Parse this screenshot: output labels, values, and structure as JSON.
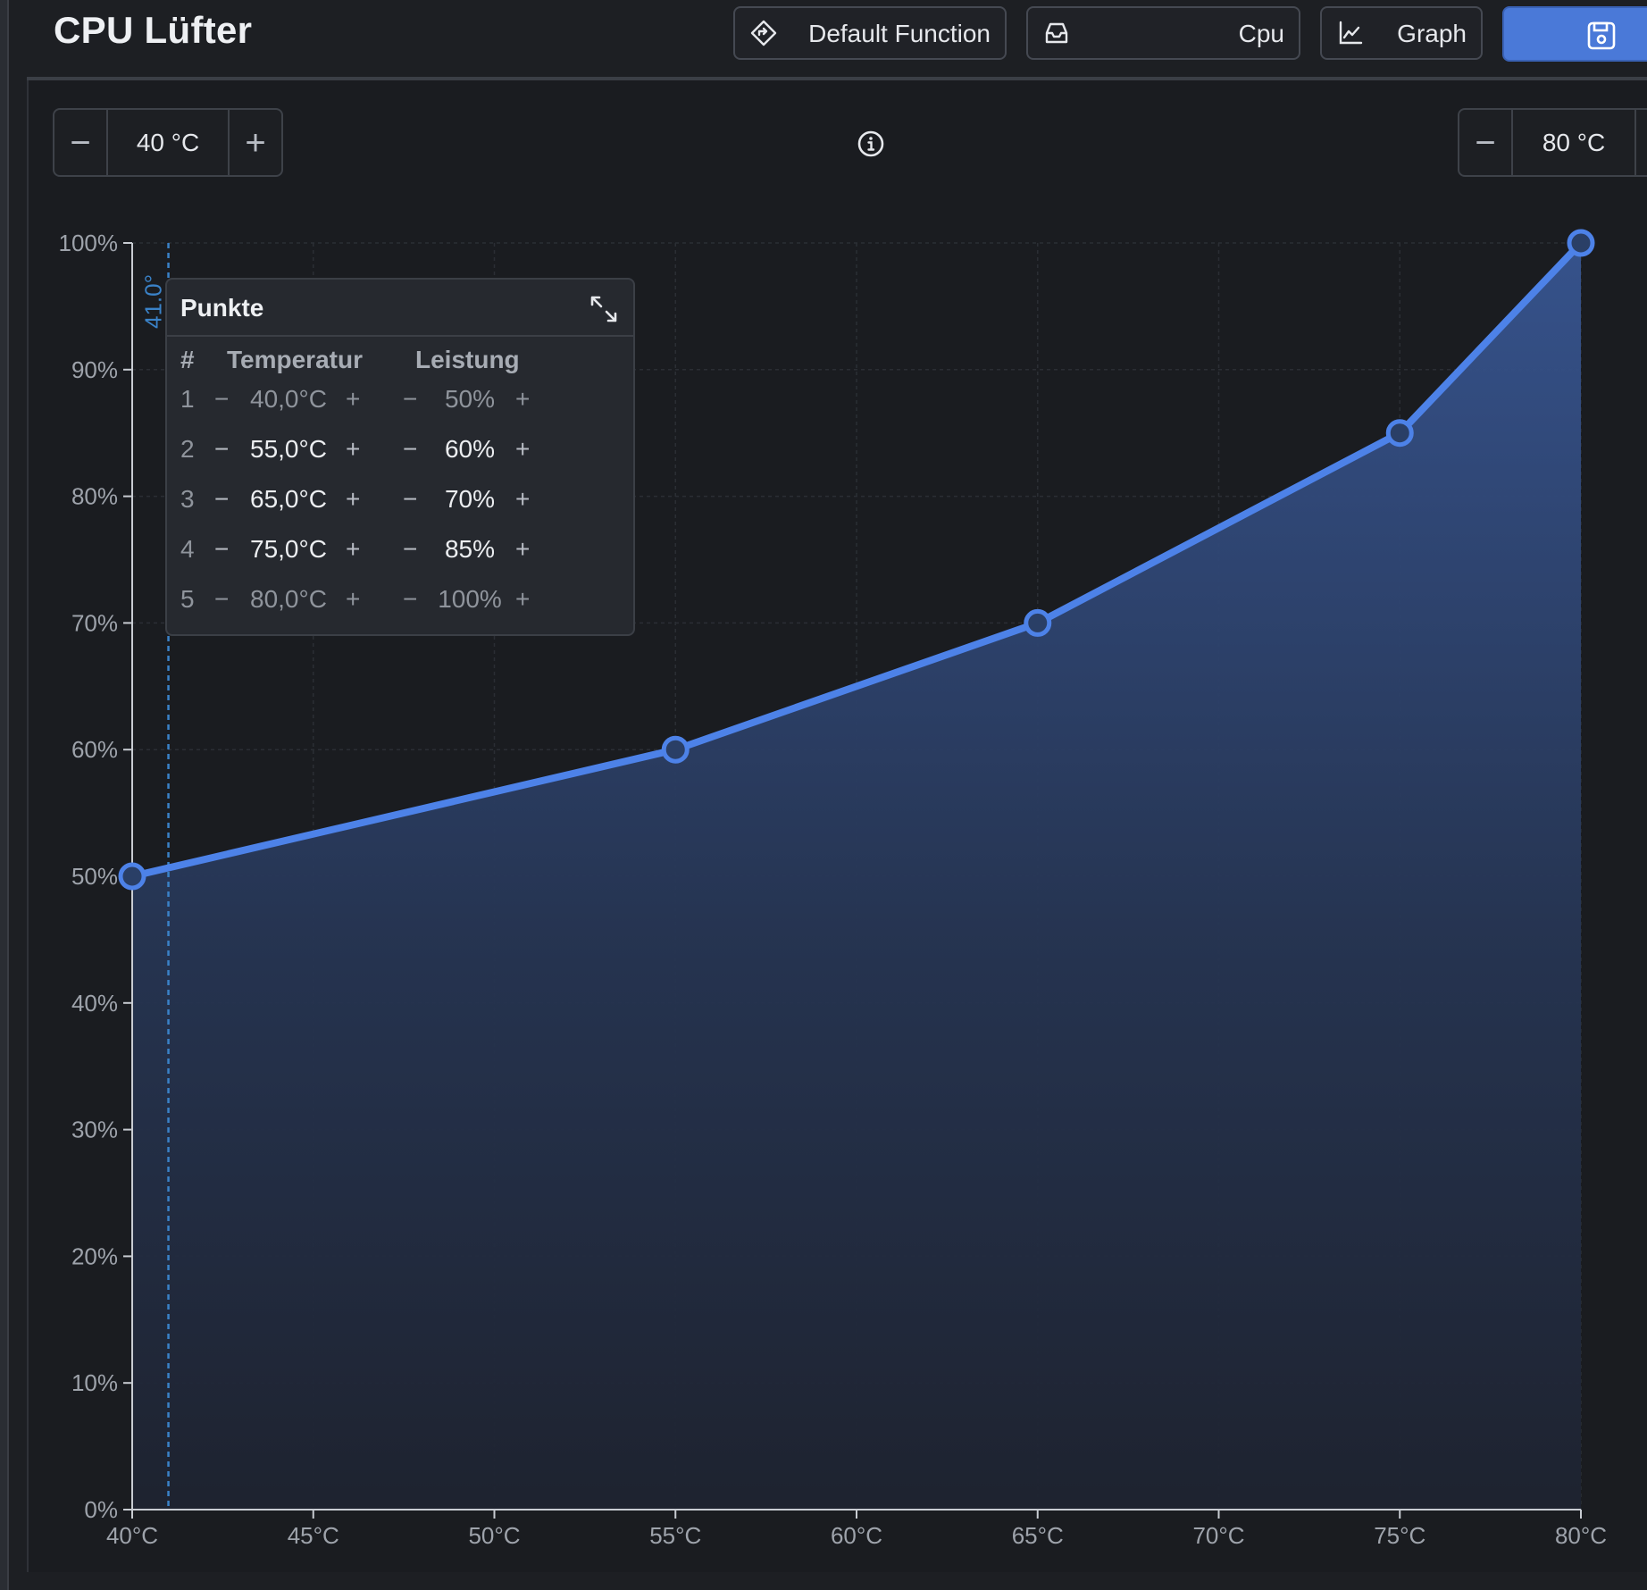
{
  "window": {
    "title": "CPU Lüfter"
  },
  "toolbar": {
    "function_label": "Default Function",
    "sensor_label": "Cpu",
    "graph_label": "Graph"
  },
  "range": {
    "min_value": "40 °C",
    "max_value": "80 °C"
  },
  "points_panel": {
    "title": "Punkte",
    "col_num": "#",
    "col_temp": "Temperatur",
    "col_power": "Leistung",
    "rows": [
      {
        "num": "1",
        "temp": "40,0°C",
        "power": "50%"
      },
      {
        "num": "2",
        "temp": "55,0°C",
        "power": "60%"
      },
      {
        "num": "3",
        "temp": "65,0°C",
        "power": "70%"
      },
      {
        "num": "4",
        "temp": "75,0°C",
        "power": "85%"
      },
      {
        "num": "5",
        "temp": "80,0°C",
        "power": "100%"
      }
    ]
  },
  "chart_data": {
    "type": "area",
    "x": [
      40,
      55,
      65,
      75,
      80
    ],
    "values": [
      50,
      60,
      70,
      85,
      100
    ],
    "xlim": [
      40,
      80
    ],
    "ylim": [
      0,
      100
    ],
    "x_ticks": [
      "40°C",
      "45°C",
      "50°C",
      "55°C",
      "60°C",
      "65°C",
      "70°C",
      "75°C",
      "80°C"
    ],
    "y_ticks": [
      "0%",
      "10%",
      "20%",
      "30%",
      "40%",
      "50%",
      "60%",
      "70%",
      "80%",
      "90%",
      "100%"
    ],
    "current_marker": {
      "x": 41.0,
      "label": "41.0°"
    },
    "grid": true,
    "colors": {
      "line": "#4d82e8",
      "fill": "#2f4a7a",
      "marker": "#3a82c8"
    }
  },
  "colors": {
    "accent": "#4a79d8",
    "background": "#1a1c20"
  },
  "icons": {
    "function": "diamond-arrow-icon",
    "sensor": "inbox-icon",
    "graph": "line-chart-icon",
    "save": "save-icon",
    "info": "info-icon",
    "expand": "expand-icon"
  }
}
